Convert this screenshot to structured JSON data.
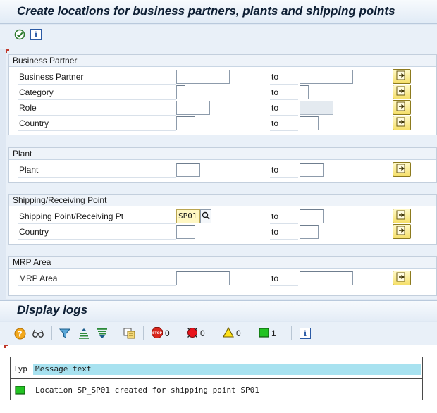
{
  "window": {
    "title": "Create locations for business partners, plants and shipping points"
  },
  "toolbar": {
    "execute_icon": "execute-clock-icon",
    "info_icon": "info-icon",
    "info_glyph": "i"
  },
  "groups": {
    "business_partner": {
      "title": "Business Partner",
      "rows": [
        {
          "label": "Business Partner",
          "to": "to",
          "from_value": "",
          "to_value": ""
        },
        {
          "label": "Category",
          "to": "to",
          "from_value": "",
          "to_value": ""
        },
        {
          "label": "Role",
          "to": "to",
          "from_value": "",
          "to_value": ""
        },
        {
          "label": "Country",
          "to": "to",
          "from_value": "",
          "to_value": ""
        }
      ]
    },
    "plant": {
      "title": "Plant",
      "rows": [
        {
          "label": "Plant",
          "to": "to",
          "from_value": "",
          "to_value": ""
        }
      ]
    },
    "shipping": {
      "title": "Shipping/Receiving Point",
      "rows": [
        {
          "label": "Shipping Point/Receiving Pt",
          "to": "to",
          "from_value": "SP01",
          "to_value": ""
        },
        {
          "label": "Country",
          "to": "to",
          "from_value": "",
          "to_value": ""
        }
      ]
    },
    "mrp": {
      "title": "MRP Area",
      "rows": [
        {
          "label": "MRP Area",
          "to": "to",
          "from_value": "",
          "to_value": ""
        }
      ]
    }
  },
  "logs": {
    "title": "Display logs",
    "toolbar": {
      "help_glyph": "?",
      "stop_glyph": "STOP",
      "errors_count": "0",
      "error_count": "0",
      "warning_count": "0",
      "success_count": "1",
      "info_glyph": "i"
    },
    "table": {
      "col_type": "Typ",
      "col_message": "Message text",
      "rows": [
        {
          "type": "success",
          "message": "Location SP_SP01 created for shipping point SP01"
        }
      ]
    }
  },
  "colors": {
    "accent_blue": "#2b5aa5",
    "header_highlight": "#a8e2f0",
    "success_green": "#22c322",
    "multi_button_yellow": "#f5df6a"
  }
}
